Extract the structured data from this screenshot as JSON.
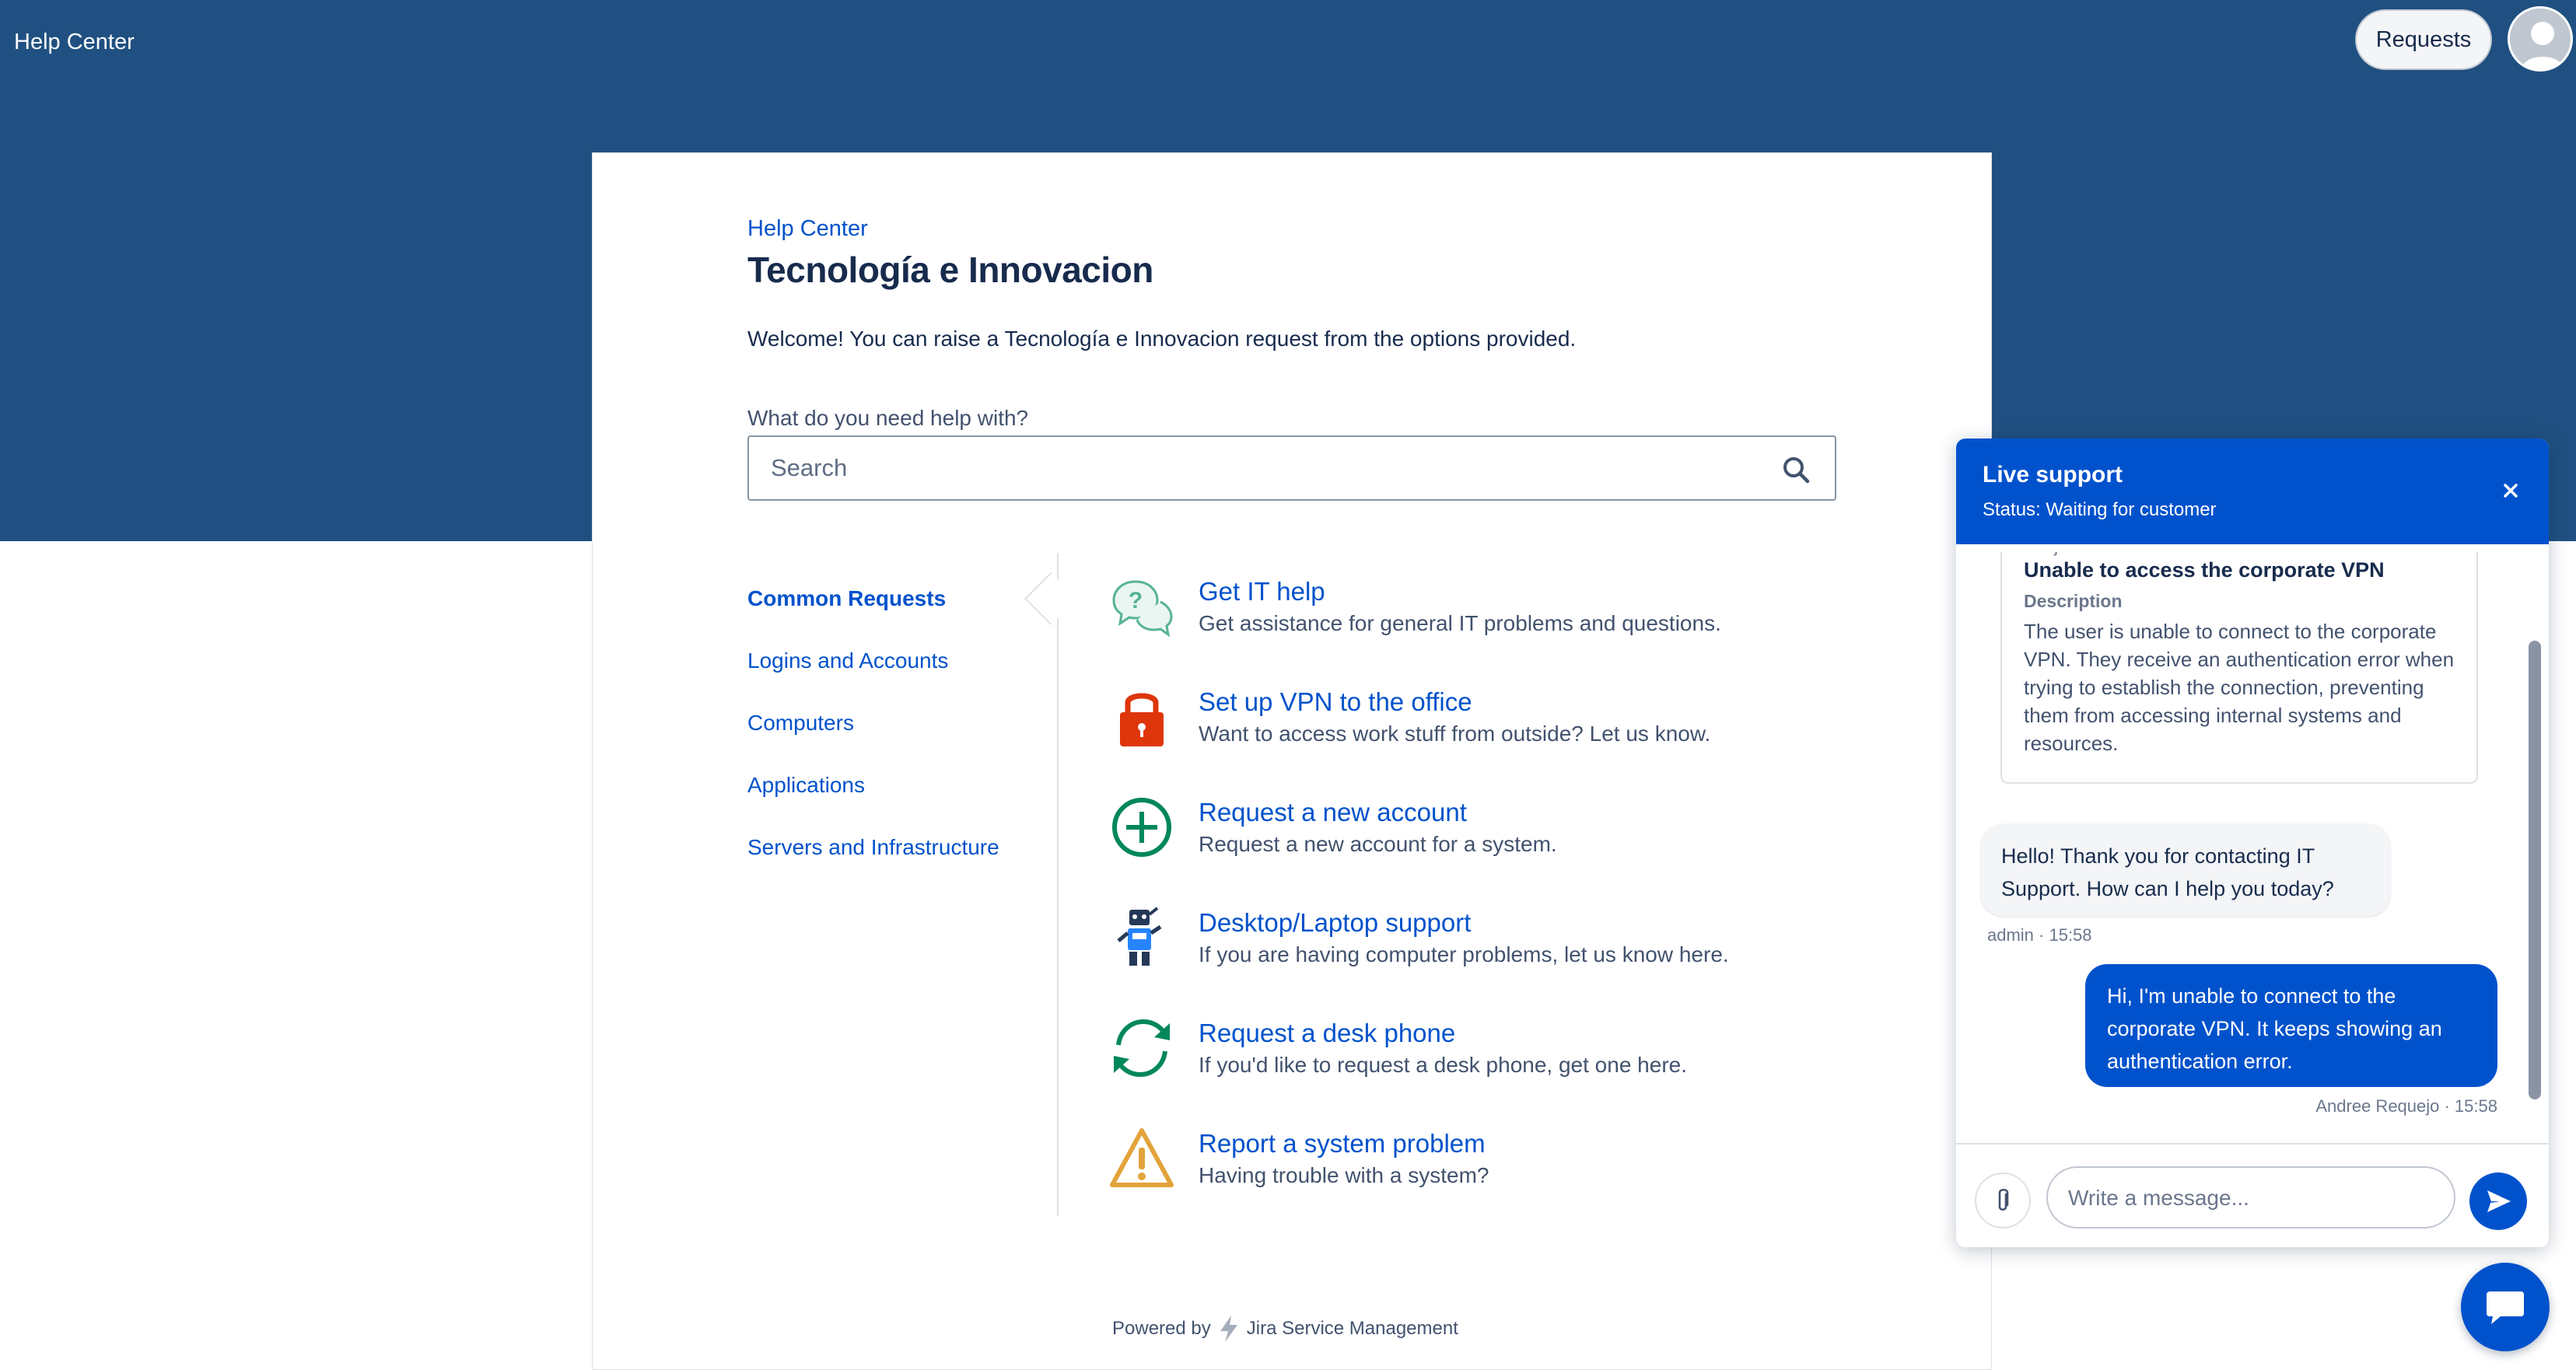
{
  "header": {
    "brand": "Help Center",
    "requests_label": "Requests"
  },
  "portal": {
    "breadcrumb": "Help Center",
    "title": "Tecnología e Innovacion",
    "welcome": "Welcome! You can raise a Tecnología e Innovacion request from the options provided.",
    "search_label": "What do you need help with?",
    "search_placeholder": "Search"
  },
  "categories": [
    {
      "label": "Common Requests",
      "active": true
    },
    {
      "label": "Logins and Accounts",
      "active": false
    },
    {
      "label": "Computers",
      "active": false
    },
    {
      "label": "Applications",
      "active": false
    },
    {
      "label": "Servers and Infrastructure",
      "active": false
    }
  ],
  "request_types": [
    {
      "title": "Get IT help",
      "description": "Get assistance for general IT problems and questions.",
      "icon": "speech-bubbles-icon"
    },
    {
      "title": "Set up VPN to the office",
      "description": "Want to access work stuff from outside? Let us know.",
      "icon": "padlock-icon"
    },
    {
      "title": "Request a new account",
      "description": "Request a new account for a system.",
      "icon": "plus-circle-icon"
    },
    {
      "title": "Desktop/Laptop support",
      "description": "If you are having computer problems, let us know here.",
      "icon": "robot-icon"
    },
    {
      "title": "Request a desk phone",
      "description": "If you'd like to request a desk phone, get one here.",
      "icon": "refresh-arrows-icon"
    },
    {
      "title": "Report a system problem",
      "description": "Having trouble with a system?",
      "icon": "warning-triangle-icon"
    }
  ],
  "footer": {
    "powered_by": "Powered by",
    "product": "Jira Service Management"
  },
  "chat": {
    "title": "Live support",
    "status": "Status: Waiting for customer",
    "summary": {
      "subject_label": "Subject",
      "subject": "Unable to access the corporate VPN",
      "description_label": "Description",
      "description": "The user is unable to connect to the corporate VPN. They receive an authentication error when trying to establish the connection, preventing them from accessing internal systems and resources."
    },
    "messages": [
      {
        "from": "agent",
        "text": "Hello! Thank you for contacting IT Support. How can I help you today?",
        "meta": "admin · 15:58"
      },
      {
        "from": "user",
        "text": "Hi, I'm unable to connect to the corporate VPN. It keeps showing an authentication error.",
        "meta": "Andree Requejo · 15:58"
      }
    ],
    "input_placeholder": "Write a message..."
  },
  "colors": {
    "header_bg": "#205081",
    "link": "#0052cc",
    "chat_accent": "#0052cc"
  }
}
